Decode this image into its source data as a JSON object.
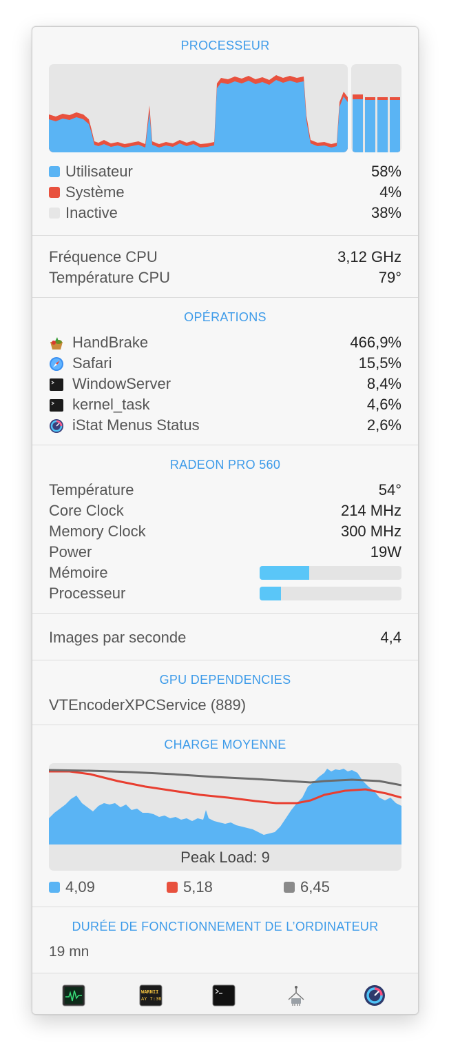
{
  "processor": {
    "title": "PROCESSEUR",
    "legend": [
      {
        "label": "Utilisateur",
        "value": "58%",
        "color": "#5ab4f4"
      },
      {
        "label": "Système",
        "value": "4%",
        "color": "#e8513e"
      },
      {
        "label": "Inactive",
        "value": "38%",
        "color": "#e6e6e6"
      }
    ],
    "freq_label": "Fréquence CPU",
    "freq_value": "3,12 GHz",
    "temp_label": "Température CPU",
    "temp_value": "79°"
  },
  "processes": {
    "title": "OPÉRATIONS",
    "items": [
      {
        "name": "HandBrake",
        "value": "466,9%",
        "icon": "handbrake-icon"
      },
      {
        "name": "Safari",
        "value": "15,5%",
        "icon": "safari-icon"
      },
      {
        "name": "WindowServer",
        "value": "8,4%",
        "icon": "terminal-icon"
      },
      {
        "name": "kernel_task",
        "value": "4,6%",
        "icon": "terminal-icon"
      },
      {
        "name": "iStat Menus Status",
        "value": "2,6%",
        "icon": "istat-icon"
      }
    ]
  },
  "gpu": {
    "title": "RADEON PRO 560",
    "rows": [
      {
        "label": "Température",
        "value": "54°"
      },
      {
        "label": "Core Clock",
        "value": "214 MHz"
      },
      {
        "label": "Memory Clock",
        "value": "300 MHz"
      },
      {
        "label": "Power",
        "value": "19W"
      }
    ],
    "memory_label": "Mémoire",
    "memory_usage": 0.35,
    "processor_label": "Processeur",
    "processor_usage": 0.15
  },
  "fps": {
    "label": "Images par seconde",
    "value": "4,4"
  },
  "gpu_dependencies": {
    "title": "GPU DEPENDENCIES",
    "item": "VTEncoderXPCService (889)"
  },
  "load": {
    "title": "CHARGE MOYENNE",
    "peak": "Peak Load: 9",
    "legend": [
      {
        "value": "4,09",
        "color": "#5ab4f4"
      },
      {
        "value": "5,18",
        "color": "#e8513e"
      },
      {
        "value": "6,45",
        "color": "#8a8a8a"
      }
    ]
  },
  "uptime": {
    "title": "DURÉE DE FONCTIONNEMENT DE L’ORDINATEUR",
    "value": "19 mn"
  },
  "dock": {
    "icons": [
      "activity-monitor-icon",
      "console-icon",
      "terminal-icon",
      "system-information-icon",
      "istat-menus-icon"
    ],
    "console_text_1": "WARNII",
    "console_text_2": "AY 7:36"
  }
}
